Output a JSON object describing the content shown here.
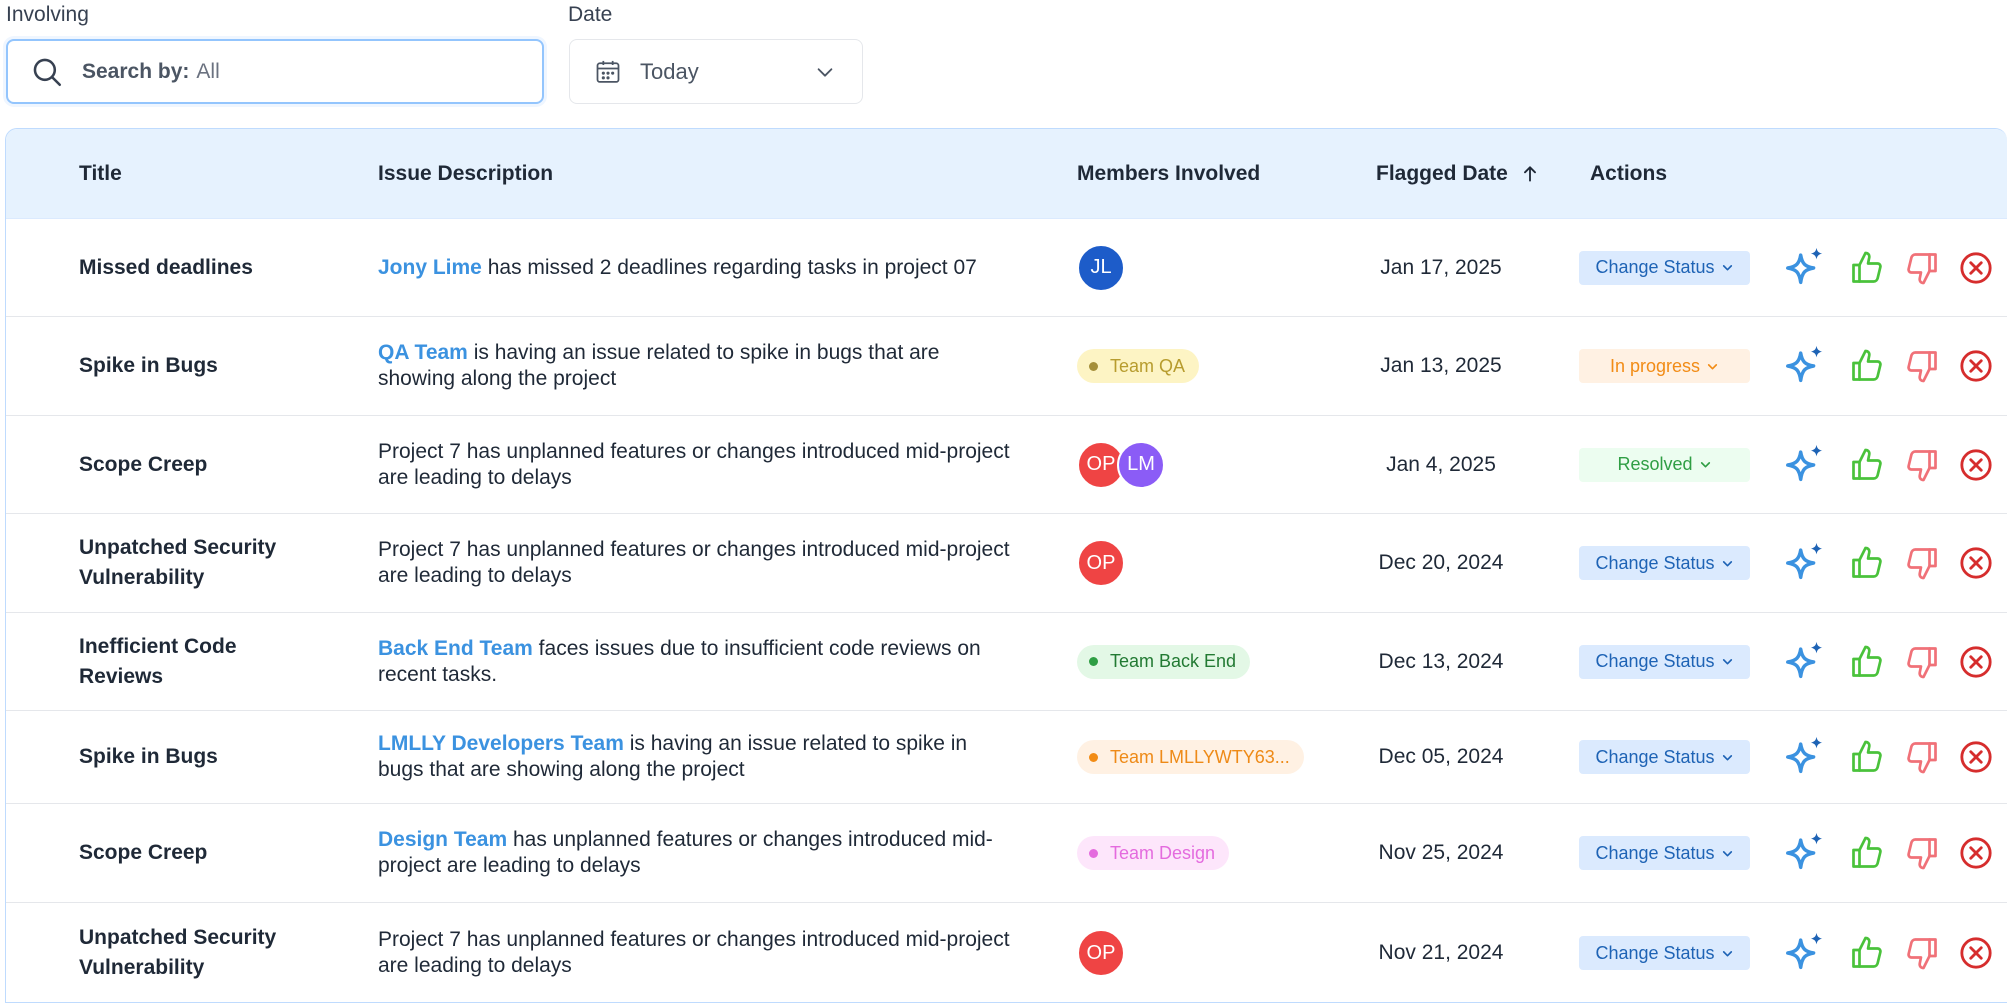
{
  "filters": {
    "involving_label": "Involving",
    "search_prefix": "Search by:",
    "search_value": "All",
    "date_label": "Date",
    "date_value": "Today"
  },
  "table": {
    "columns": {
      "title": "Title",
      "description": "Issue Description",
      "members": "Members Involved",
      "flagged_date": "Flagged Date",
      "actions": "Actions"
    }
  },
  "colors": {
    "blue_accent": "#3b92e0",
    "status_default_bg": "#dbeafe",
    "status_default_text": "#1e63b5",
    "status_progress_bg": "#fff1e3",
    "status_progress_text": "#f28c16",
    "status_resolved_bg": "#ecfdf0",
    "status_resolved_text": "#2f9e44",
    "like": "#4ac23b",
    "dislike": "#f07178",
    "reject": "#d62d2d"
  },
  "rows": [
    {
      "title": "Missed deadlines",
      "desc_highlight": "Jony Lime",
      "desc_text": " has missed 2 deadlines regarding tasks in project 07",
      "avatars": [
        {
          "initials": "JL",
          "color": "#1d5cc9"
        }
      ],
      "team": null,
      "date": "Jan 17, 2025",
      "status": "Change Status",
      "status_kind": "default"
    },
    {
      "title": "Spike in Bugs",
      "desc_highlight": "QA Team",
      "desc_text": " is having an issue related to spike in bugs that are showing along the project",
      "avatars": [],
      "team": {
        "label": "Team QA",
        "bg": "#fdf4c4",
        "fg": "#b79c2e",
        "dot": "#a58f3a"
      },
      "date": "Jan 13, 2025",
      "status": "In progress",
      "status_kind": "progress"
    },
    {
      "title": "Scope Creep",
      "desc_highlight": "",
      "desc_text": "Project 7 has unplanned features or changes introduced mid-project are leading to delays",
      "avatars": [
        {
          "initials": "OP",
          "color": "#ef4444"
        },
        {
          "initials": "LM",
          "color": "#8b5cf6"
        }
      ],
      "team": null,
      "date": "Jan 4, 2025",
      "status": "Resolved",
      "status_kind": "resolved"
    },
    {
      "title": "Unpatched Security Vulnerability",
      "desc_highlight": "",
      "desc_text": "Project 7 has unplanned features or changes introduced mid-project are leading to delays",
      "avatars": [
        {
          "initials": "OP",
          "color": "#ef4444"
        }
      ],
      "team": null,
      "date": "Dec 20, 2024",
      "status": "Change Status",
      "status_kind": "default"
    },
    {
      "title": "Inefficient Code Reviews",
      "desc_highlight": "Back End Team",
      "desc_text": " faces issues due to insufficient code reviews on recent tasks.",
      "avatars": [],
      "team": {
        "label": "Team Back End",
        "bg": "#e3f8e6",
        "fg": "#227a33",
        "dot": "#2f9e44"
      },
      "date": "Dec 13, 2024",
      "status": "Change Status",
      "status_kind": "default"
    },
    {
      "title": "Spike in Bugs",
      "desc_highlight": "LMLLY Developers Team",
      "desc_text": " is having an issue related to spike in bugs that are showing along the project",
      "avatars": [],
      "team": {
        "label": "Team LMLLYWTY63...",
        "bg": "#fff1e3",
        "fg": "#ee8a17",
        "dot": "#f28c16"
      },
      "date": "Dec 05, 2024",
      "status": "Change Status",
      "status_kind": "default"
    },
    {
      "title": "Scope Creep",
      "desc_highlight": "Design Team ",
      "desc_text": " has unplanned features or changes introduced mid-project are leading to delays",
      "avatars": [],
      "team": {
        "label": "Team Design",
        "bg": "#fde6fb",
        "fg": "#e46bde",
        "dot": "#e46bde"
      },
      "date": "Nov 25, 2024",
      "status": "Change Status",
      "status_kind": "default"
    },
    {
      "title": "Unpatched Security Vulnerability",
      "desc_highlight": "",
      "desc_text": "Project 7 has unplanned features or changes introduced mid-project are leading to delays",
      "avatars": [
        {
          "initials": "OP",
          "color": "#ef4444"
        }
      ],
      "team": null,
      "date": "Nov 21, 2024",
      "status": "Change Status",
      "status_kind": "default"
    }
  ]
}
